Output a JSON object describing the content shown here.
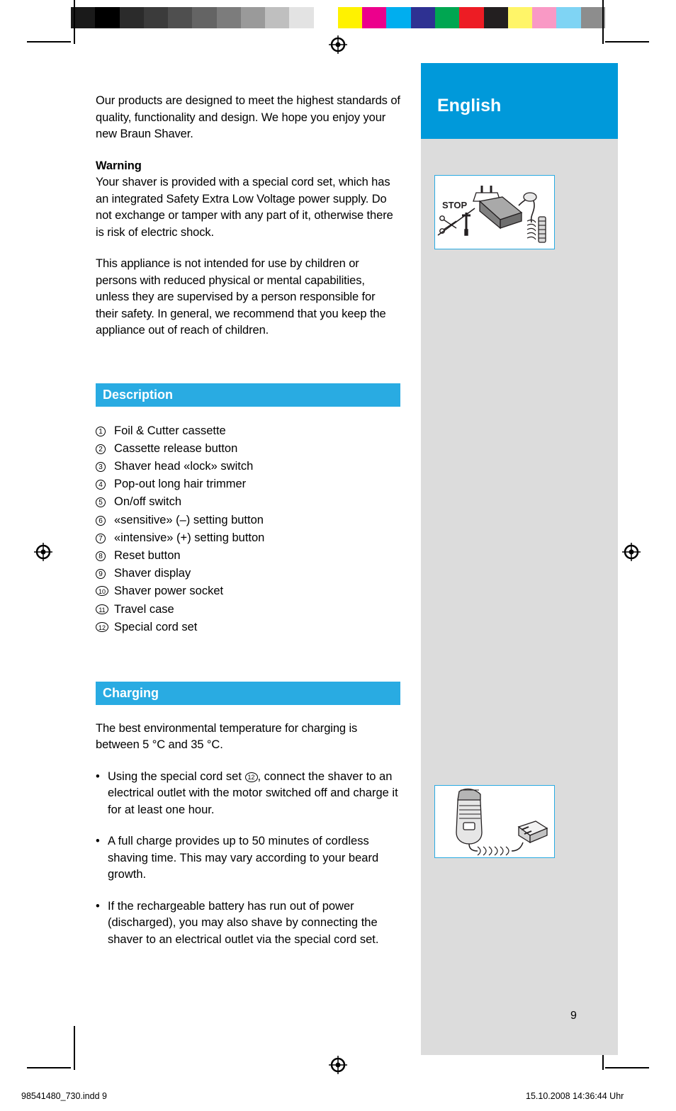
{
  "colorbar": {
    "swatches": [
      "#1a1a1a",
      "#000000",
      "#2b2b2b",
      "#3b3b3b",
      "#4f4f4f",
      "#646464",
      "#7c7c7c",
      "#9a9a9a",
      "#bfbfbf",
      "#e3e3e3",
      "#ffffff",
      "#fff200",
      "#ec008c",
      "#00aeef",
      "#2e3192",
      "#00a651",
      "#ed1c24",
      "#231f20",
      "#fff568",
      "#f999c5",
      "#7fd4f4",
      "#8d8d8d"
    ]
  },
  "language": {
    "title": "English"
  },
  "intro": {
    "paragraph": "Our products are designed to meet the highest standards of quality, functionality and design. We hope you enjoy your new Braun Shaver."
  },
  "warning": {
    "heading": "Warning",
    "paragraph": "Your shaver is provided with a special cord set, which has an integrated Safety Extra Low Voltage power supply. Do not exchange or tamper with any part of it, otherwise there is risk of electric shock.",
    "paragraph2": "This appliance is not intended for use by children or persons with reduced physical or mental capabilities, unless they are supervised by a person responsible for their safety. In general, we recommend that you keep the appliance out of reach of children."
  },
  "description": {
    "heading": "Description",
    "items": [
      {
        "num": "1",
        "label": "Foil & Cutter cassette"
      },
      {
        "num": "2",
        "label": "Cassette release button"
      },
      {
        "num": "3",
        "label": "Shaver head «lock» switch"
      },
      {
        "num": "4",
        "label": "Pop-out long hair trimmer"
      },
      {
        "num": "5",
        "label": "On/off switch"
      },
      {
        "num": "6",
        "label": "«sensitive» (–) setting button"
      },
      {
        "num": "7",
        "label": "«intensive» (+) setting button"
      },
      {
        "num": "8",
        "label": "Reset button"
      },
      {
        "num": "9",
        "label": "Shaver display"
      },
      {
        "num": "10",
        "label": "Shaver power socket"
      },
      {
        "num": "11",
        "label": "Travel case"
      },
      {
        "num": "12",
        "label": "Special cord set"
      }
    ]
  },
  "charging": {
    "heading": "Charging",
    "intro": "The best environmental temperature for charging is between 5 °C and 35 °C.",
    "bullets": [
      {
        "pre": "Using the special cord set ",
        "ref": "12",
        "post": ", connect the shaver to an electrical outlet with the motor switched off and charge it for at least one hour."
      },
      {
        "pre": "A full charge provides up to 50 minutes of cordless shaving time. This may vary according to your beard growth.",
        "ref": "",
        "post": ""
      },
      {
        "pre": "If the rechargeable battery has run out of power (discharged), you may also shave by connecting the shaver to an electrical outlet via the special cord set.",
        "ref": "",
        "post": ""
      }
    ]
  },
  "figures": {
    "cordset_label": "STOP",
    "cordset_name": "special-cord-set-illustration",
    "charging_name": "shaver-charging-illustration"
  },
  "page_number": "9",
  "footer": {
    "left": "98541480_730.indd   9",
    "right": "15.10.2008   14:36:44 Uhr"
  },
  "colors": {
    "accent": "#29ABE2",
    "lang_bar": "#0099DA",
    "grey_column": "#DCDCDC"
  }
}
